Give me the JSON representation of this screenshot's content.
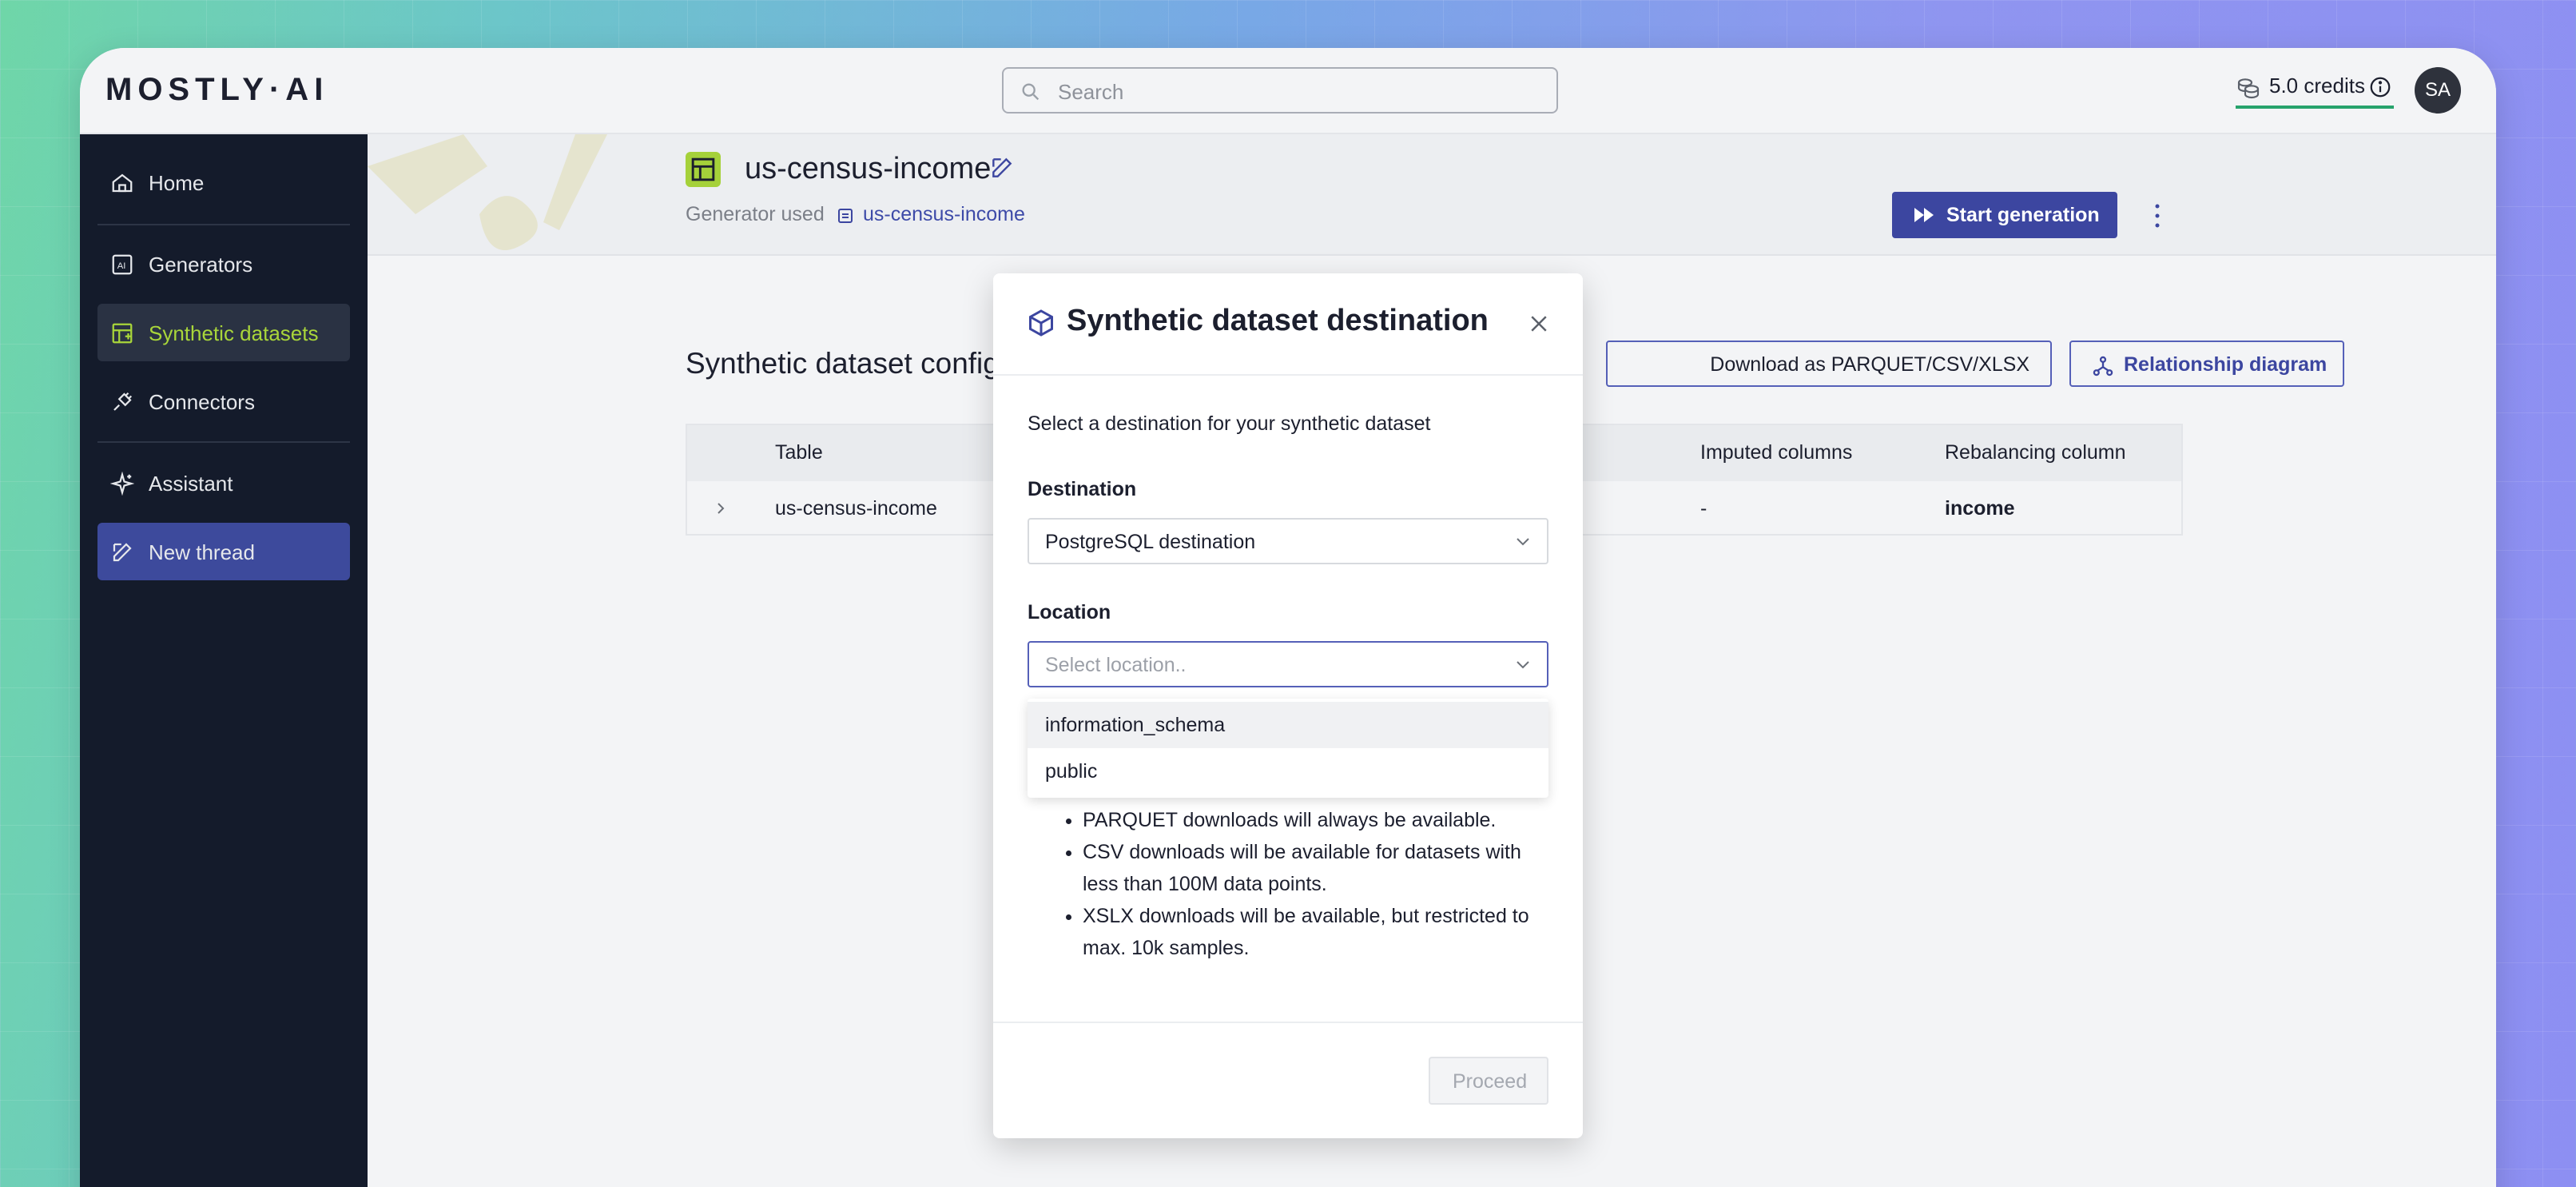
{
  "app": {
    "logo": "MOSTLY·AI",
    "search_placeholder": "Search",
    "credits": "5.0 credits",
    "avatar_initials": "SA"
  },
  "sidebar": {
    "items": [
      {
        "label": "Home",
        "icon": "home-icon"
      },
      {
        "label": "Generators",
        "icon": "generator-icon"
      },
      {
        "label": "Synthetic datasets",
        "icon": "dataset-icon",
        "active": true
      },
      {
        "label": "Connectors",
        "icon": "plug-icon"
      },
      {
        "label": "Assistant",
        "icon": "sparkle-icon"
      },
      {
        "label": "New thread",
        "icon": "edit-icon"
      }
    ]
  },
  "header": {
    "title": "us-census-income",
    "generator_used_label": "Generator used",
    "generator_link": "us-census-income",
    "start_button": "Start generation"
  },
  "main": {
    "section_title": "Synthetic dataset config",
    "download_button": "Download as PARQUET/CSV/XLSX",
    "relationship_button": "Relationship diagram",
    "table": {
      "headers": [
        "Table",
        "Imputed columns",
        "Rebalancing column"
      ],
      "rows": [
        {
          "table": "us-census-income",
          "imputed": "-",
          "rebalancing": "income"
        }
      ]
    }
  },
  "modal": {
    "title": "Synthetic dataset destination",
    "description": "Select a destination for your synthetic dataset",
    "destination_label": "Destination",
    "destination_value": "PostgreSQL destination",
    "location_label": "Location",
    "location_placeholder": "Select location..",
    "location_options": [
      "information_schema",
      "public"
    ],
    "bullets": [
      "PARQUET downloads will always be available.",
      "CSV downloads will be available for datasets with less than 100M data points.",
      "XSLX downloads will be available, but restricted to max. 10k samples."
    ],
    "proceed_button": "Proceed"
  },
  "colors": {
    "sidebar_bg": "#141b2b",
    "active_accent": "#a9d63a",
    "primary": "#3c46a0",
    "credits_underline": "#27a36c"
  }
}
